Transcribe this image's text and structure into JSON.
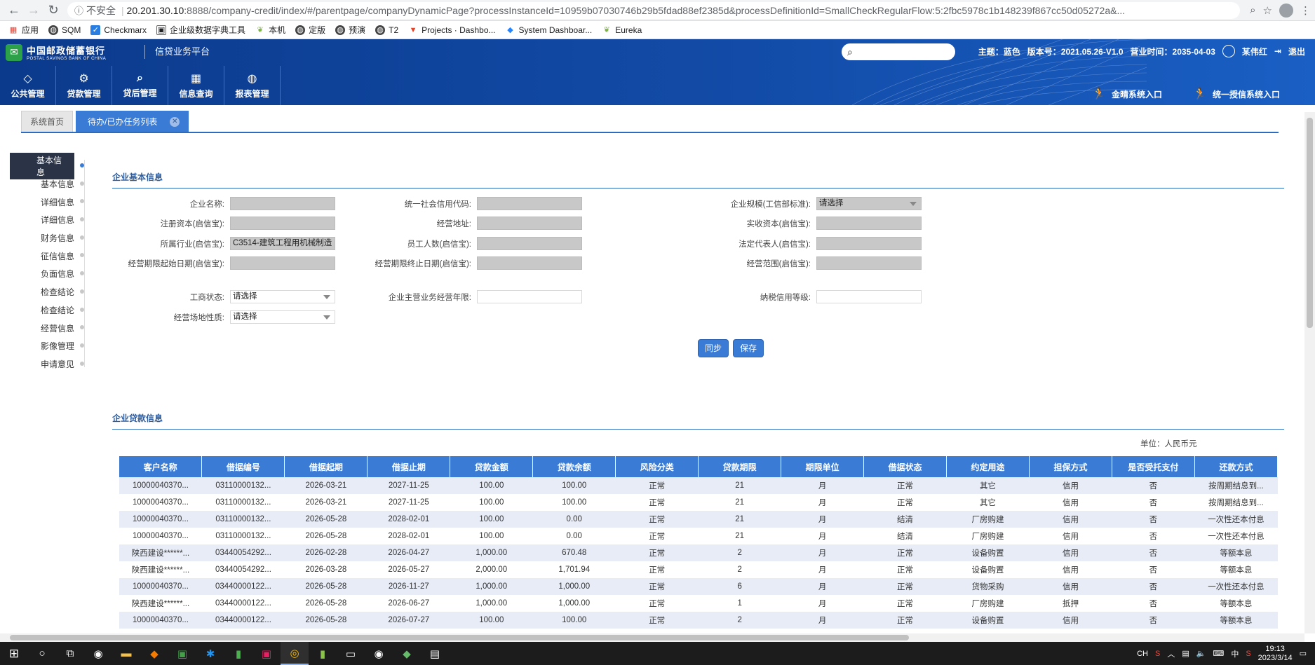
{
  "browser": {
    "insecure_label": "不安全",
    "url_host": "20.201.30.10",
    "url_rest": ":8888/company-credit/index/#/parentpage/companyDynamicPage?processInstanceId=10959b07030746b29b5fdad88ef2385d&processDefinitionId=SmallCheckRegularFlow:5:2fbc5978c1b148239f867cc50d05272a&...",
    "bookmarks": [
      "应用",
      "SQM",
      "Checkmarx",
      "企业级数据字典工具",
      "本机",
      "定版",
      "预演",
      "T2",
      "Projects · Dashbo...",
      "System Dashboar...",
      "Eureka"
    ]
  },
  "header": {
    "bank_name_cn": "中国邮政储蓄银行",
    "bank_name_en": "POSTAL SAVINGS BANK OF CHINA",
    "platform": "信贷业务平台",
    "theme": "主题：蓝色",
    "version": "版本号：2021.05.26-V1.0",
    "biz_time": "营业时间：2035-04-03",
    "user": "某伟红",
    "logout": "退出",
    "menu": [
      "公共管理",
      "贷款管理",
      "贷后管理",
      "信息查询",
      "报表管理"
    ],
    "entries": [
      "金晴系统入口",
      "统一授信系统入口"
    ]
  },
  "tabs": {
    "home": "系统首页",
    "active": "待办/已办任务列表"
  },
  "side_nav": [
    "基本信息",
    "基本信息",
    "详细信息",
    "详细信息",
    "财务信息",
    "征信信息",
    "负面信息",
    "检查结论",
    "检查结论",
    "经营信息",
    "影像管理",
    "申请意见"
  ],
  "basic_info": {
    "title": "企业基本信息",
    "labels": {
      "company_name": "企业名称:",
      "credit_code": "统一社会信用代码:",
      "scale": "企业规模(工信部标准):",
      "reg_capital": "注册资本(启信宝):",
      "biz_address": "经营地址:",
      "paid_capital": "实收资本(启信宝):",
      "industry": "所属行业(启信宝):",
      "employees": "员工人数(启信宝):",
      "legal_rep": "法定代表人(启信宝):",
      "term_start": "经营期限起始日期(启信宝):",
      "term_end": "经营期限终止日期(启信宝):",
      "biz_scope": "经营范围(启信宝):",
      "reg_status": "工商状态:",
      "main_biz_years": "企业主营业务经营年限:",
      "tax_grade": "纳税信用等级:",
      "site_nature": "经营场地性质:"
    },
    "values": {
      "scale": "请选择",
      "industry": "C3514-建筑工程用机械制造",
      "reg_status": "请选择",
      "site_nature": "请选择"
    },
    "buttons": {
      "sync": "同步",
      "save": "保存"
    }
  },
  "loan_info": {
    "title": "企业贷款信息",
    "unit": "单位：人民币元",
    "columns": [
      "客户名称",
      "借据编号",
      "借据起期",
      "借据止期",
      "贷款金额",
      "贷款余额",
      "风险分类",
      "贷款期限",
      "期限单位",
      "借据状态",
      "约定用途",
      "担保方式",
      "是否受托支付",
      "还款方式"
    ],
    "rows": [
      [
        "10000040370...",
        "03110000132...",
        "2026-03-21",
        "2027-11-25",
        "100.00",
        "100.00",
        "正常",
        "21",
        "月",
        "正常",
        "其它",
        "信用",
        "否",
        "按周期结息到..."
      ],
      [
        "10000040370...",
        "03110000132...",
        "2026-03-21",
        "2027-11-25",
        "100.00",
        "100.00",
        "正常",
        "21",
        "月",
        "正常",
        "其它",
        "信用",
        "否",
        "按周期结息到..."
      ],
      [
        "10000040370...",
        "03110000132...",
        "2026-05-28",
        "2028-02-01",
        "100.00",
        "0.00",
        "正常",
        "21",
        "月",
        "结清",
        "厂房购建",
        "信用",
        "否",
        "一次性还本付息"
      ],
      [
        "10000040370...",
        "03110000132...",
        "2026-05-28",
        "2028-02-01",
        "100.00",
        "0.00",
        "正常",
        "21",
        "月",
        "结清",
        "厂房购建",
        "信用",
        "否",
        "一次性还本付息"
      ],
      [
        "陕西建设******...",
        "03440054292...",
        "2026-02-28",
        "2026-04-27",
        "1,000.00",
        "670.48",
        "正常",
        "2",
        "月",
        "正常",
        "设备购置",
        "信用",
        "否",
        "等额本息"
      ],
      [
        "陕西建设******...",
        "03440054292...",
        "2026-03-28",
        "2026-05-27",
        "2,000.00",
        "1,701.94",
        "正常",
        "2",
        "月",
        "正常",
        "设备购置",
        "信用",
        "否",
        "等额本息"
      ],
      [
        "10000040370...",
        "03440000122...",
        "2026-05-28",
        "2026-11-27",
        "1,000.00",
        "1,000.00",
        "正常",
        "6",
        "月",
        "正常",
        "货物采购",
        "信用",
        "否",
        "一次性还本付息"
      ],
      [
        "陕西建设******...",
        "03440000122...",
        "2026-05-28",
        "2026-06-27",
        "1,000.00",
        "1,000.00",
        "正常",
        "1",
        "月",
        "正常",
        "厂房购建",
        "抵押",
        "否",
        "等额本息"
      ],
      [
        "10000040370...",
        "03440000122...",
        "2026-05-28",
        "2026-07-27",
        "100.00",
        "100.00",
        "正常",
        "2",
        "月",
        "正常",
        "设备购置",
        "信用",
        "否",
        "等额本息"
      ]
    ]
  },
  "taskbar": {
    "time": "19:13",
    "date": "2023/3/14",
    "ime": "中",
    "lang": "CH"
  }
}
